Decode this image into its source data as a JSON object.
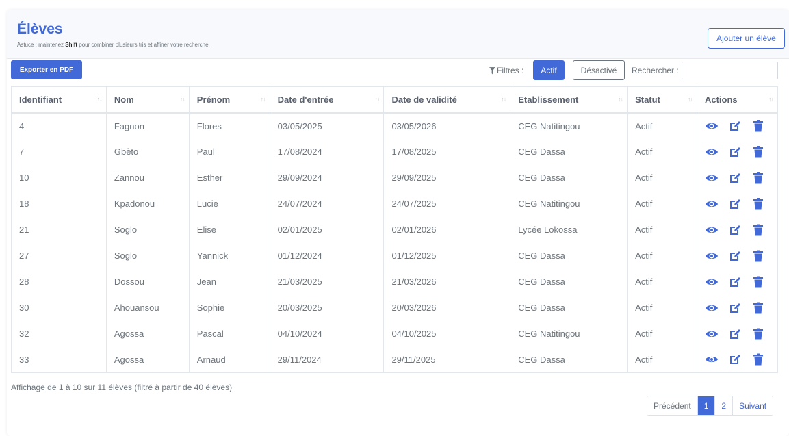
{
  "header": {
    "title": "Élèves",
    "hint_prefix": "Astuce : maintenez ",
    "hint_key": "Shift",
    "hint_suffix": " pour combiner plusieurs tris et affiner votre recherche.",
    "add_button": "Ajouter un élève"
  },
  "toolbar": {
    "export_pdf": "Exporter en PDF",
    "filters_label": "Filtres :",
    "filter_active": "Actif",
    "filter_inactive": "Désactivé",
    "search_label": "Rechercher :",
    "search_value": ""
  },
  "table": {
    "columns": [
      "Identifiant",
      "Nom",
      "Prénom",
      "Date d'entrée",
      "Date de validité",
      "Etablissement",
      "Statut",
      "Actions"
    ],
    "rows": [
      [
        "4",
        "Fagnon",
        "Flores",
        "03/05/2025",
        "03/05/2026",
        "CEG Natitingou",
        "Actif"
      ],
      [
        "7",
        "Gbèto",
        "Paul",
        "17/08/2024",
        "17/08/2025",
        "CEG Dassa",
        "Actif"
      ],
      [
        "10",
        "Zannou",
        "Esther",
        "29/09/2024",
        "29/09/2025",
        "CEG Dassa",
        "Actif"
      ],
      [
        "18",
        "Kpadonou",
        "Lucie",
        "24/07/2024",
        "24/07/2025",
        "CEG Natitingou",
        "Actif"
      ],
      [
        "21",
        "Soglo",
        "Elise",
        "02/01/2025",
        "02/01/2026",
        "Lycée Lokossa",
        "Actif"
      ],
      [
        "27",
        "Soglo",
        "Yannick",
        "01/12/2024",
        "01/12/2025",
        "CEG Dassa",
        "Actif"
      ],
      [
        "28",
        "Dossou",
        "Jean",
        "21/03/2025",
        "21/03/2026",
        "CEG Dassa",
        "Actif"
      ],
      [
        "30",
        "Ahouansou",
        "Sophie",
        "20/03/2025",
        "20/03/2026",
        "CEG Dassa",
        "Actif"
      ],
      [
        "32",
        "Agossa",
        "Pascal",
        "04/10/2024",
        "04/10/2025",
        "CEG Natitingou",
        "Actif"
      ],
      [
        "33",
        "Agossa",
        "Arnaud",
        "29/11/2024",
        "29/11/2025",
        "CEG Dassa",
        "Actif"
      ]
    ],
    "action_icons": [
      "eye-icon",
      "edit-icon",
      "trash-icon"
    ]
  },
  "footer": {
    "info": "Affichage de 1 à 10 sur 11 élèves (filtré à partir de 40 élèves)",
    "prev": "Précédent",
    "pages": [
      "1",
      "2"
    ],
    "current_page": "1",
    "next": "Suivant"
  },
  "colors": {
    "accent": "#4169d8",
    "muted_text": "#6c757d"
  }
}
